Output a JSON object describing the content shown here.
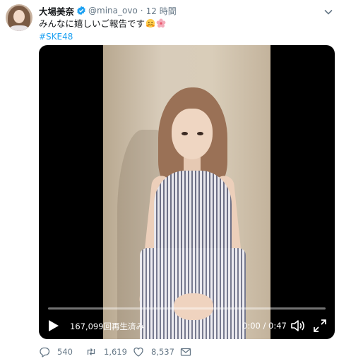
{
  "tweet": {
    "author_name": "大場美奈",
    "handle": "@mina_ovo",
    "separator": "·",
    "time": "12 時間",
    "text": "みんなに嬉しいご報告です",
    "emojis": [
      "hugging-face-icon",
      "cherry-blossom-icon"
    ],
    "hashtag": "#SKE48",
    "verified": true
  },
  "video": {
    "views": "167,099回再生済み",
    "timecode": "0:00 / 0:47",
    "progress": 0,
    "icons": [
      "play-icon",
      "volume-icon",
      "fullscreen-icon"
    ]
  },
  "actions": {
    "reply_count": "540",
    "retweet_count": "1,619",
    "like_count": "8,537"
  },
  "colors": {
    "accent": "#1da1f2",
    "muted": "#657786",
    "text": "#14171a"
  }
}
